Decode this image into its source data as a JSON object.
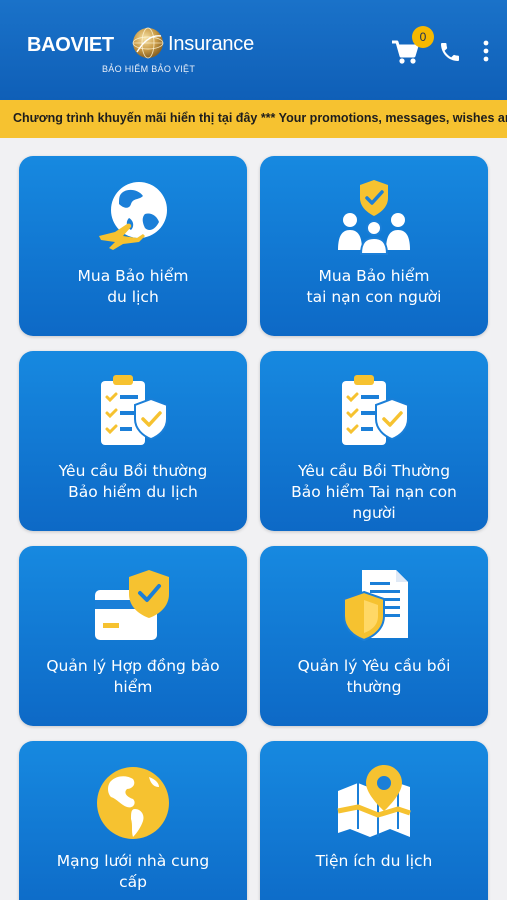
{
  "header": {
    "brand_bao": "BAOVIET",
    "brand_insurance": "Insurance",
    "brand_sub": "BẢO HIỂM BẢO VIỆT",
    "cart_count": "0",
    "icons": [
      "cart-icon",
      "phone-icon",
      "more-vertical-icon"
    ],
    "colors": {
      "primary": "#0f5fb7",
      "accent": "#f6c230"
    }
  },
  "ticker": {
    "text": "Chương trình khuyến mãi hiển thị tại đây *** Your promotions, messages, wishes and g"
  },
  "tiles": [
    {
      "label_1": "Mua Bảo hiểm",
      "label_2": "du lịch",
      "label_3": "",
      "icon": "globe-plane-icon"
    },
    {
      "label_1": "Mua Bảo hiểm",
      "label_2": "tai nạn con người",
      "label_3": "",
      "icon": "family-shield-icon"
    },
    {
      "label_1": "Yêu cầu Bồi thường",
      "label_2": "Bảo hiểm du lịch",
      "label_3": "",
      "icon": "checklist-shield-icon"
    },
    {
      "label_1": "Yêu cầu Bồi Thường",
      "label_2": "Bảo hiểm Tai nạn con",
      "label_3": "người",
      "icon": "checklist-shield-icon"
    },
    {
      "label_1": "Quản lý Hợp đồng bảo",
      "label_2": "hiểm",
      "label_3": "",
      "icon": "card-shield-icon"
    },
    {
      "label_1": "Quản lý Yêu cầu bồi",
      "label_2": "thường",
      "label_3": "",
      "icon": "document-shield-icon"
    },
    {
      "label_1": "Mạng lưới nhà cung",
      "label_2": "cấp",
      "label_3": "",
      "icon": "globe-americas-icon"
    },
    {
      "label_1": "Tiện ích du lịch",
      "label_2": "",
      "label_3": "",
      "icon": "map-pin-icon"
    }
  ]
}
